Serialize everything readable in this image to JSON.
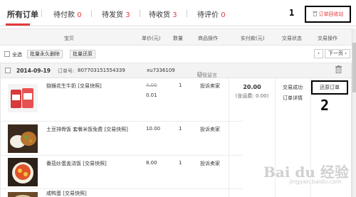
{
  "tabs": [
    {
      "label": "所有订单",
      "count": ""
    },
    {
      "label": "待付款",
      "count": "0"
    },
    {
      "label": "待发货",
      "count": "3"
    },
    {
      "label": "待收货",
      "count": "3"
    },
    {
      "label": "待评价",
      "count": "0"
    }
  ],
  "recycle_bin": {
    "label": "订单回收站"
  },
  "annotations": {
    "one": "1",
    "two": "2"
  },
  "table_header": {
    "item": "宝贝",
    "unit_price": "单价(元)",
    "quantity": "数量",
    "item_action": "商品操作",
    "paid": "实付款(元)",
    "status": "交易状态",
    "action": "交易操作"
  },
  "batch": {
    "select_all": "全选",
    "delete_label": "批量永久删除",
    "restore_label": "批量还原",
    "next_label": "下一页"
  },
  "order": {
    "date": "2014-09-19",
    "number_label": "订单号:",
    "number": "807703151554339",
    "seller": "xu7336109",
    "message_label": "给我留言",
    "total": "20.00",
    "shipping": "(含运费: 0.00)",
    "status": "交易成功",
    "detail_label": "订单详情",
    "restore_button": "还原订单",
    "items": [
      {
        "title": "猕猴花生牛奶 [交易快照]",
        "original_price": "4.00",
        "price": "0.01",
        "qty": "1",
        "service": "投诉卖家"
      },
      {
        "title": "土豆排骨饭 套餐米饭免费 [交易快照]",
        "original_price": "",
        "price": "10.00",
        "qty": "1",
        "service": "投诉卖家"
      },
      {
        "title": "番茄炒蛋盖浇饭 [交易快照]",
        "original_price": "",
        "price": "8.00",
        "qty": "1",
        "service": "投诉卖家"
      },
      {
        "title": "咸鸭蛋 [交易快照]",
        "original_price": "",
        "price": "",
        "qty": "",
        "service": ""
      }
    ]
  },
  "watermark": {
    "brand": "Bai du 经验",
    "url": "jingyan.baidu.com"
  },
  "colors": {
    "accent": "#e4393c",
    "header_bg": "#f5f5f5",
    "border": "#e5e5e5"
  }
}
